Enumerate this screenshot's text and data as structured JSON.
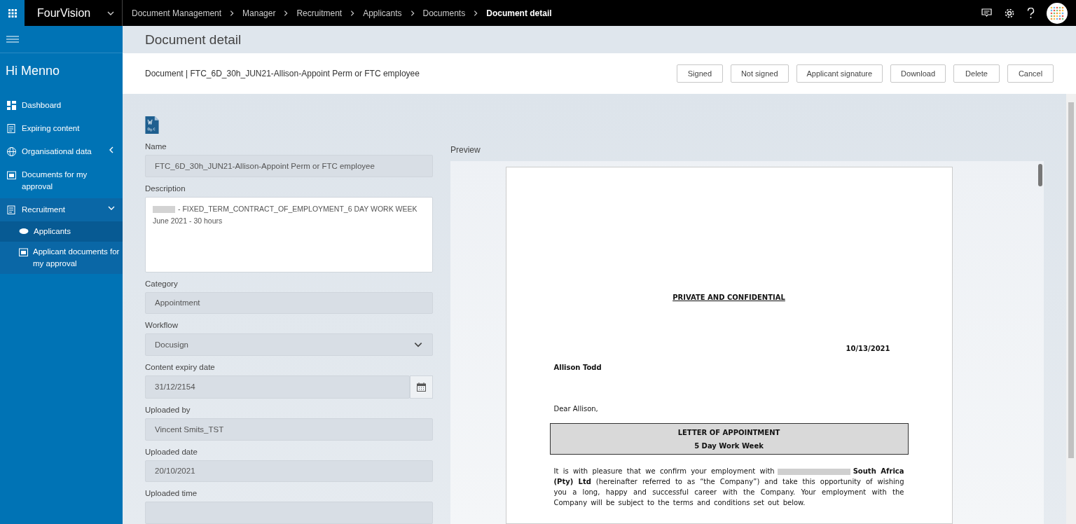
{
  "app": {
    "name": "FourVision"
  },
  "breadcrumbs": [
    {
      "label": "Document Management",
      "selected": false
    },
    {
      "label": "Manager",
      "selected": false
    },
    {
      "label": "Recruitment",
      "selected": false
    },
    {
      "label": "Applicants",
      "selected": false
    },
    {
      "label": "Documents",
      "selected": false
    },
    {
      "label": "Document detail",
      "selected": true
    }
  ],
  "sidebar": {
    "greeting": "Hi Menno",
    "items": [
      {
        "label": "Dashboard"
      },
      {
        "label": "Expiring content"
      },
      {
        "label": "Organisational data",
        "expanded": false
      },
      {
        "label": "Documents for my approval"
      },
      {
        "label": "Recruitment",
        "expanded": true,
        "children": [
          {
            "label": "Applicants",
            "selected": true
          },
          {
            "label": "Applicant documents for my approval",
            "selected": false
          }
        ]
      }
    ]
  },
  "page": {
    "title": "Document detail"
  },
  "action_bar": {
    "document_label": "Document | FTC_6D_30h_JUN21-Allison-Appoint Perm or FTC employee",
    "buttons": [
      "Signed",
      "Not signed",
      "Applicant signature",
      "Download",
      "Delete",
      "Cancel"
    ]
  },
  "form": {
    "fields": [
      {
        "kind": "text",
        "label": "Name",
        "value": "FTC_6D_30h_JUN21-Allison-Appoint Perm or FTC employee"
      },
      {
        "kind": "textarea",
        "label": "Description",
        "redacted": true,
        "lines": [
          "- FIXED_TERM_CONTRACT_OF_EMPLOYMENT_6 DAY WORK WEEK",
          "June 2021 - 30 hours"
        ]
      },
      {
        "kind": "text",
        "label": "Category",
        "value": "Appointment"
      },
      {
        "kind": "select",
        "label": "Workflow",
        "value": "Docusign"
      },
      {
        "kind": "date",
        "label": "Content expiry date",
        "value": "31/12/2154"
      },
      {
        "kind": "text",
        "label": "Uploaded by",
        "value": "Vincent Smits_TST"
      },
      {
        "kind": "text",
        "label": "Uploaded date",
        "value": "20/10/2021"
      },
      {
        "kind": "text",
        "label": "Uploaded time"
      }
    ]
  },
  "preview": {
    "label": "Preview",
    "document": {
      "heading": "PRIVATE AND CONFIDENTIAL",
      "date": "10/13/2021",
      "recipient": "Allison Todd",
      "salutation": "Dear Allison,",
      "box_lines": [
        "LETTER OF APPOINTMENT",
        "5 Day Work Week"
      ],
      "paragraph": {
        "before": "It is with pleasure that we confirm your employment with",
        "redacted": true,
        "after": "**South Africa (Pty) Ltd** (hereinafter referred to as “the Company”) and take this opportunity of wishing you a long, happy and successful career with the Company.  Your employment with the Company will be subject to the terms and conditions set out below."
      }
    }
  }
}
